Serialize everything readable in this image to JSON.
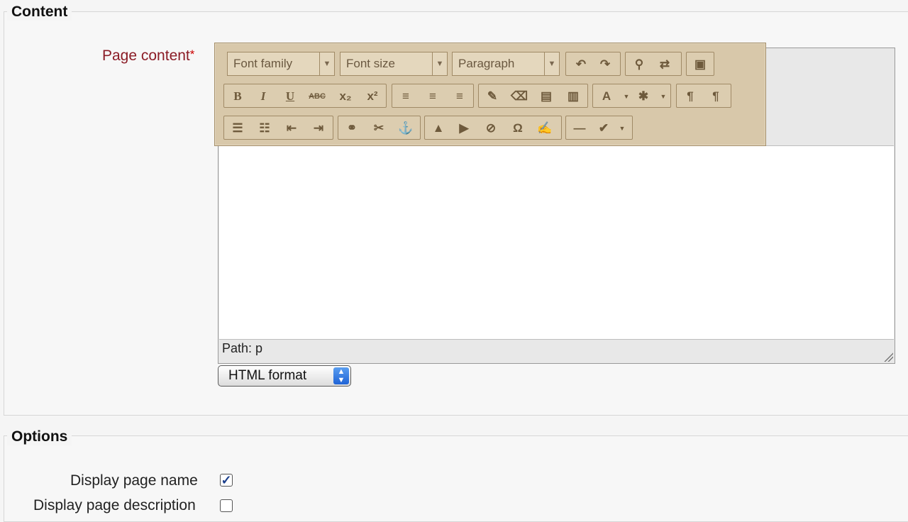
{
  "content_section": {
    "legend": "Content",
    "page_content_label": "Page content",
    "required_mark": "*",
    "editor": {
      "toolbar": {
        "font_family": "Font family",
        "font_size": "Font size",
        "format": "Paragraph",
        "row1_icons": [
          "undo-icon",
          "redo-icon",
          "find-icon",
          "replace-icon",
          "fullscreen-icon"
        ],
        "row2_icons": [
          "bold-icon",
          "italic-icon",
          "underline-icon",
          "strikethrough-icon",
          "subscript-icon",
          "superscript-icon",
          "align-left-icon",
          "align-center-icon",
          "align-right-icon",
          "cleanup-icon",
          "remove-format-icon",
          "paste-text-icon",
          "paste-word-icon",
          "text-color-icon",
          "background-color-icon",
          "ltr-icon",
          "rtl-icon"
        ],
        "row3_icons": [
          "bullet-list-icon",
          "numbered-list-icon",
          "outdent-icon",
          "indent-icon",
          "link-icon",
          "unlink-icon",
          "anchor-icon",
          "image-icon",
          "media-icon",
          "no-autolink-icon",
          "special-char-icon",
          "edit-html-icon",
          "horizontal-rule-icon",
          "spellcheck-icon"
        ]
      },
      "path_text": "Path: p"
    },
    "format_select": "HTML format"
  },
  "options_section": {
    "legend": "Options",
    "display_page_name": {
      "label": "Display page name",
      "checked": true
    },
    "display_page_description": {
      "label": "Display page description",
      "checked": false
    }
  }
}
